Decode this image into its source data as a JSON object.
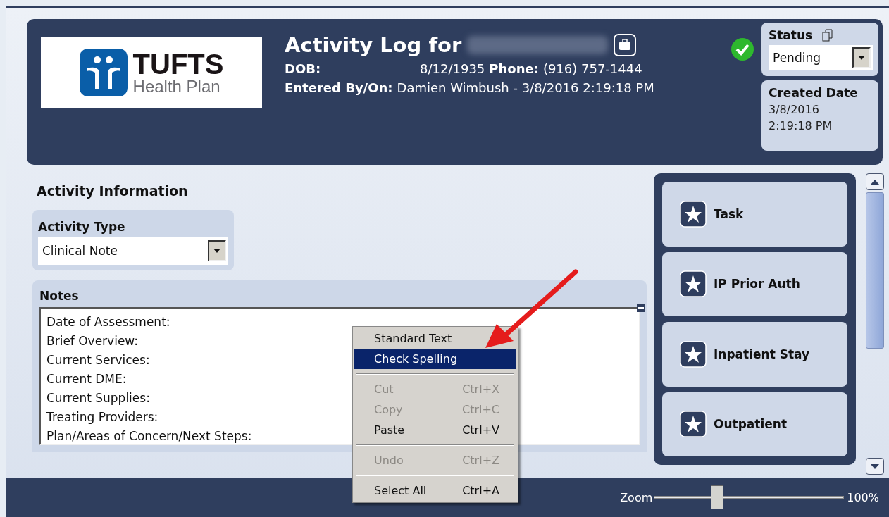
{
  "header": {
    "logo": {
      "wordmark": "TUFTS",
      "subtitle": "Health Plan"
    },
    "title": "Activity Log for",
    "dob_label": "DOB:",
    "dob": "8/12/1935",
    "phone_label": "Phone:",
    "phone": "(916) 757-1444",
    "entered_label": "Entered By/On:",
    "entered": "Damien Wimbush - 3/8/2016 2:19:18 PM",
    "status": {
      "label": "Status",
      "value": "Pending"
    },
    "created": {
      "label": "Created Date",
      "date": "3/8/2016",
      "time": "2:19:18 PM"
    }
  },
  "activity": {
    "heading": "Activity Information",
    "type_label": "Activity Type",
    "type_value": "Clinical Note"
  },
  "notes": {
    "label": "Notes",
    "lines": [
      "Date of Assessment:",
      "Brief Overview:",
      "Current Services:",
      "Current DME:",
      "Current Supplies:",
      "Treating Providers:",
      "Plan/Areas of Concern/Next Steps:"
    ]
  },
  "context_menu": [
    {
      "kind": "item",
      "label": "Standard Text",
      "disabled": false,
      "selected": false
    },
    {
      "kind": "item",
      "label": "Check Spelling",
      "disabled": false,
      "selected": true
    },
    {
      "kind": "separator"
    },
    {
      "kind": "item",
      "label": "Cut",
      "shortcut": "Ctrl+X",
      "disabled": true,
      "selected": false
    },
    {
      "kind": "item",
      "label": "Copy",
      "shortcut": "Ctrl+C",
      "disabled": true,
      "selected": false
    },
    {
      "kind": "item",
      "label": "Paste",
      "shortcut": "Ctrl+V",
      "disabled": false,
      "selected": false
    },
    {
      "kind": "separator"
    },
    {
      "kind": "item",
      "label": "Undo",
      "shortcut": "Ctrl+Z",
      "disabled": true,
      "selected": false
    },
    {
      "kind": "separator"
    },
    {
      "kind": "item",
      "label": "Select All",
      "shortcut": "Ctrl+A",
      "disabled": false,
      "selected": false
    }
  ],
  "actions": [
    {
      "label": "Task"
    },
    {
      "label": "IP Prior Auth"
    },
    {
      "label": "Inpatient Stay"
    },
    {
      "label": "Outpatient"
    }
  ],
  "zoom": {
    "label": "Zoom",
    "level": 0.32,
    "reading": "100%"
  }
}
